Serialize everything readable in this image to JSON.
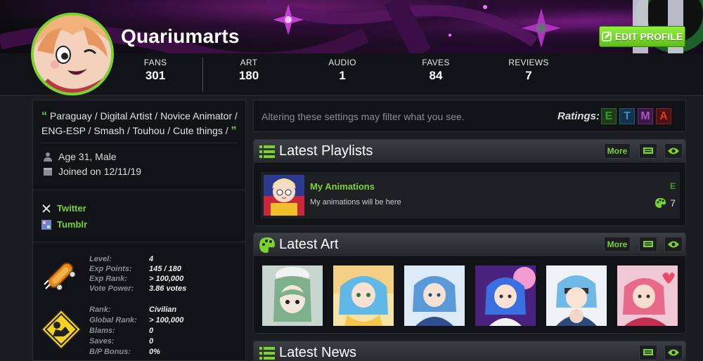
{
  "profile": {
    "username": "Quariumarts",
    "edit_label": "EDIT PROFILE",
    "accent": "#7bd32e"
  },
  "stats": [
    {
      "label": "FANS",
      "value": "301"
    },
    {
      "label": "ART",
      "value": "180"
    },
    {
      "label": "AUDIO",
      "value": "1"
    },
    {
      "label": "FAVES",
      "value": "84"
    },
    {
      "label": "REVIEWS",
      "value": "7"
    }
  ],
  "bio": {
    "open_quote": "“",
    "text": "Paraguay / Digital Artist / Novice Animator / ENG-ESP / Smash / Touhou / Cute things /",
    "close_quote": "”"
  },
  "info": {
    "age": "Age 31, Male",
    "joined": "Joined on 12/11/19"
  },
  "links": [
    {
      "label": "Twitter",
      "icon": "x-icon"
    },
    {
      "label": "Tumblr",
      "icon": "tumblr-icon"
    }
  ],
  "level": {
    "rows": [
      {
        "k": "Level:",
        "v": "4"
      },
      {
        "k": "Exp Points:",
        "v": "145 / 180"
      },
      {
        "k": "Exp Rank:",
        "v": "> 100,000"
      },
      {
        "k": "Vote Power:",
        "v": "3.86 votes"
      }
    ]
  },
  "rank": {
    "rows": [
      {
        "k": "Rank:",
        "v": "Civilian"
      },
      {
        "k": "Global Rank:",
        "v": "> 100,000"
      },
      {
        "k": "Blams:",
        "v": "0"
      },
      {
        "k": "Saves:",
        "v": "0"
      },
      {
        "k": "B/P Bonus:",
        "v": "0%"
      }
    ]
  },
  "filter": {
    "message": "Altering these settings may filter what you see.",
    "ratings_label": "Ratings:",
    "ratings": [
      {
        "letter": "E",
        "color": "#3a9a2c",
        "bg": "#1e3a1a"
      },
      {
        "letter": "T",
        "color": "#3c8fc2",
        "bg": "#14324a"
      },
      {
        "letter": "M",
        "color": "#b052c8",
        "bg": "#3a1a44"
      },
      {
        "letter": "A",
        "color": "#e0322e",
        "bg": "#4a1414"
      }
    ]
  },
  "playlists": {
    "title": "Latest Playlists",
    "more": "More",
    "item": {
      "title": "My Animations",
      "desc": "My animations will be here",
      "rating": "E",
      "count": "7"
    }
  },
  "art": {
    "title": "Latest Art",
    "more": "More"
  },
  "news": {
    "title": "Latest News"
  }
}
